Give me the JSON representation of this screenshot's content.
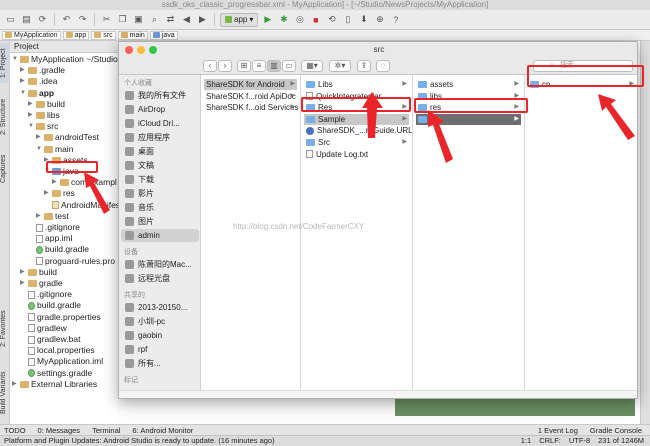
{
  "ide": {
    "title": "ssdk_oks_classic_progressbar.xml - MyApplication] - [~/Studio/NewsProjects/MyApplication]",
    "run_config": "app",
    "breadcrumb": [
      "MyApplication",
      "app",
      "src",
      "main",
      "java"
    ],
    "left_tabs": [
      "1: Project",
      "2: Structure",
      "Captures",
      "2: Favorites",
      "Build Variants"
    ],
    "project_header": "Project",
    "tree": [
      {
        "label": "MyApplication ~/Studio/Ne",
        "depth": 0,
        "icon": "folder",
        "open": true
      },
      {
        "label": ".gradle",
        "depth": 1,
        "icon": "folder"
      },
      {
        "label": ".idea",
        "depth": 1,
        "icon": "folder"
      },
      {
        "label": "app",
        "depth": 1,
        "icon": "folder",
        "open": true,
        "bold": true
      },
      {
        "label": "build",
        "depth": 2,
        "icon": "folder"
      },
      {
        "label": "libs",
        "depth": 2,
        "icon": "folder"
      },
      {
        "label": "src",
        "depth": 2,
        "icon": "folder",
        "open": true
      },
      {
        "label": "androidTest",
        "depth": 3,
        "icon": "folder"
      },
      {
        "label": "main",
        "depth": 3,
        "icon": "folder",
        "open": true
      },
      {
        "label": "assets",
        "depth": 4,
        "icon": "folder"
      },
      {
        "label": "java",
        "depth": 4,
        "icon": "folder-blue",
        "open": true
      },
      {
        "label": "com.exampl",
        "depth": 5,
        "icon": "folder"
      },
      {
        "label": "res",
        "depth": 4,
        "icon": "folder"
      },
      {
        "label": "AndroidManifest",
        "depth": 4,
        "icon": "file-xml"
      },
      {
        "label": "test",
        "depth": 3,
        "icon": "folder"
      },
      {
        "label": ".gitignore",
        "depth": 2,
        "icon": "file"
      },
      {
        "label": "app.iml",
        "depth": 2,
        "icon": "file"
      },
      {
        "label": "build.gradle",
        "depth": 2,
        "icon": "file-gradle"
      },
      {
        "label": "proguard-rules.pro",
        "depth": 2,
        "icon": "file"
      },
      {
        "label": "build",
        "depth": 1,
        "icon": "folder"
      },
      {
        "label": "gradle",
        "depth": 1,
        "icon": "folder"
      },
      {
        "label": ".gitignore",
        "depth": 1,
        "icon": "file"
      },
      {
        "label": "build.gradle",
        "depth": 1,
        "icon": "file-gradle"
      },
      {
        "label": "gradle.properties",
        "depth": 1,
        "icon": "file"
      },
      {
        "label": "gradlew",
        "depth": 1,
        "icon": "file"
      },
      {
        "label": "gradlew.bat",
        "depth": 1,
        "icon": "file"
      },
      {
        "label": "local.properties",
        "depth": 1,
        "icon": "file"
      },
      {
        "label": "MyApplication.iml",
        "depth": 1,
        "icon": "file"
      },
      {
        "label": "settings.gradle",
        "depth": 1,
        "icon": "file-gradle"
      },
      {
        "label": "External Libraries",
        "depth": 0,
        "icon": "folder"
      }
    ],
    "bottom_tabs": [
      "TODO",
      "0: Messages",
      "Terminal",
      "6: Android Monitor",
      "1 Event Log",
      "Gradle Console"
    ],
    "status_message": "Platform and Plugin Updates: Android Studio is ready to update. (16 minutes ago)",
    "status_right": [
      "1:1",
      "CRLF:",
      "UTF-8",
      "231 of 1246M"
    ]
  },
  "finder": {
    "title": "src",
    "search_placeholder": "搜索",
    "sidebar": {
      "favorites_header": "个人收藏",
      "favorites": [
        "我的所有文件",
        "AirDrop",
        "iCloud Dri...",
        "应用程序",
        "桌面",
        "文稿",
        "下载",
        "影片",
        "音乐",
        "图片",
        "admin"
      ],
      "devices_header": "设备",
      "devices": [
        "陈萧阳的Mac...",
        "远程光盘"
      ],
      "shared_header": "共享的",
      "shared": [
        "2013-20150...",
        "小圳-pc",
        "gaobin",
        "rpf",
        "所有..."
      ],
      "tags_header": "标记"
    },
    "columns": [
      [
        "ShareSDK for Android",
        "ShareSDK f...roid ApiDoc",
        "ShareSDK f...oid Services"
      ],
      [
        "Libs",
        "QuickIntegrater.jar",
        "Res",
        "Sample",
        "ShareSDK_...r_Guide.URL",
        "Src",
        "Update Log.txt"
      ],
      [
        "assets",
        "libs",
        "res",
        "src"
      ],
      [
        "cn"
      ]
    ],
    "watermark": "http://blog.csdn.net/CodeFarmerCXY"
  },
  "colors": {
    "annotation_red": "#e8262a",
    "finder_selected": "#6e6e6e"
  }
}
